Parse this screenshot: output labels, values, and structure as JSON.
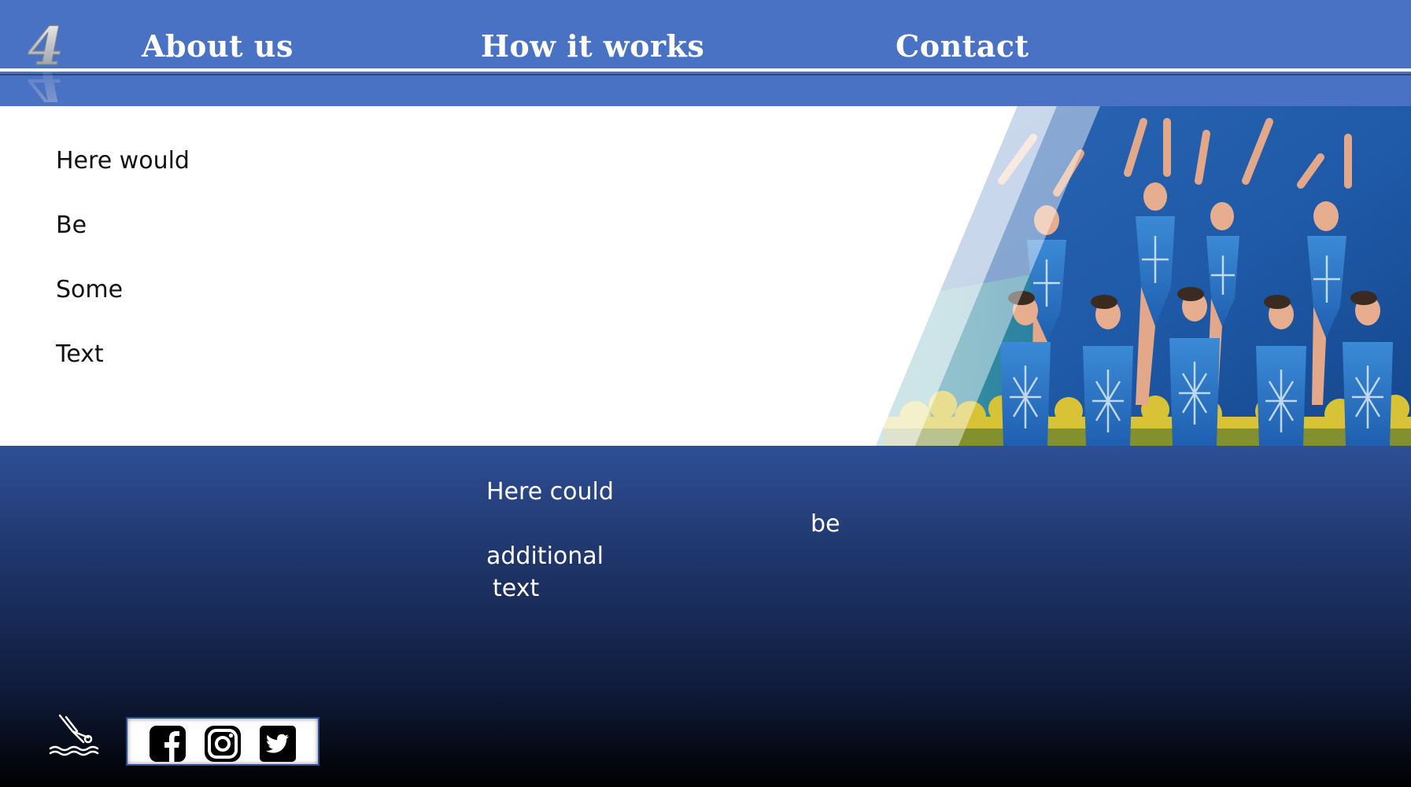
{
  "nav": {
    "logo_text": "4",
    "links": [
      {
        "label": "About us"
      },
      {
        "label": "How it works"
      },
      {
        "label": "Contact"
      }
    ]
  },
  "intro": {
    "lines": [
      "Here would",
      "Be",
      "Some",
      "Text"
    ]
  },
  "hero": {
    "icon": "synchronized-swimmers-photo"
  },
  "footer": {
    "col1": [
      "Here could",
      "additional",
      "text"
    ],
    "col2": "be"
  },
  "social": [
    {
      "name": "facebook-icon"
    },
    {
      "name": "instagram-icon"
    },
    {
      "name": "twitter-icon"
    }
  ],
  "colors": {
    "nav_bg": "#4a72c4",
    "footer_top": "#2e4f96",
    "footer_bottom": "#000000",
    "accent": "#3a7bd5"
  }
}
